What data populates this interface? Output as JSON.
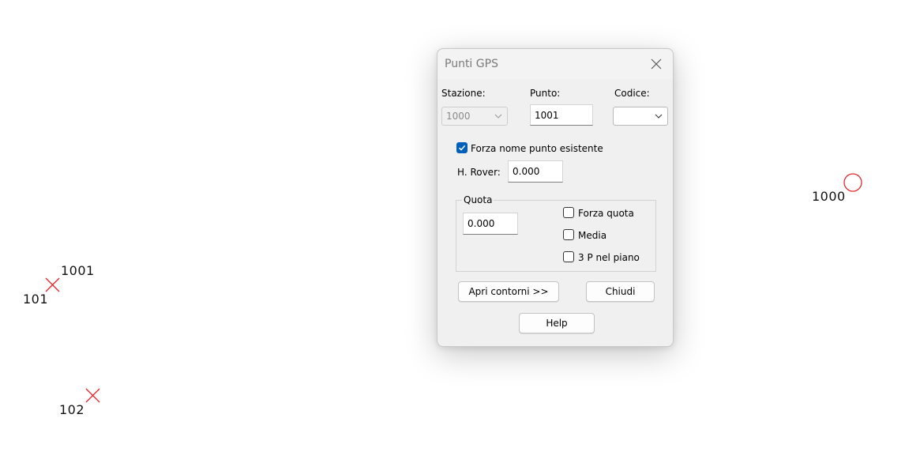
{
  "canvas": {
    "points": [
      {
        "label": "1001",
        "symbol": "cross"
      },
      {
        "label": "101",
        "symbol": "cross"
      },
      {
        "label": "102",
        "symbol": "cross"
      },
      {
        "label": "1000",
        "symbol": "circle"
      }
    ],
    "marker_color": "#e3262b"
  },
  "dialog": {
    "title": "Punti GPS",
    "stazione": {
      "label": "Stazione:",
      "value": "1000"
    },
    "punto": {
      "label": "Punto:",
      "value": "1001"
    },
    "codice": {
      "label": "Codice:",
      "value": ""
    },
    "forza_nome": {
      "label": "Forza nome punto esistente",
      "checked": true
    },
    "h_rover": {
      "label": "H. Rover:",
      "value": "0.000"
    },
    "quota_group": {
      "title": "Quota",
      "value": "0.000",
      "forza_quota": {
        "label": "Forza quota",
        "checked": false
      },
      "media": {
        "label": "Media",
        "checked": false
      },
      "tre_p": {
        "label": "3 P nel piano",
        "checked": false
      }
    },
    "buttons": {
      "apri": "Apri contorni >>",
      "chiudi": "Chiudi",
      "help": "Help"
    },
    "accent": "#005fb8"
  }
}
